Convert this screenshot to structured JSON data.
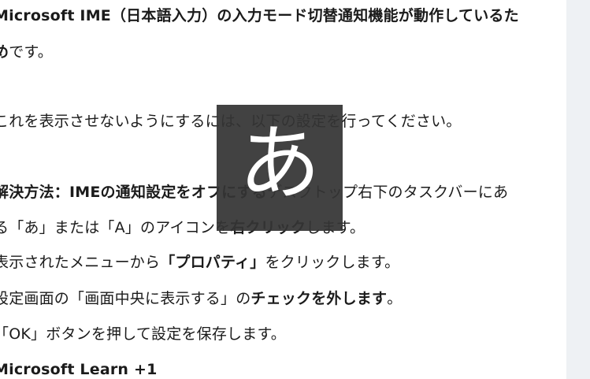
{
  "article": {
    "intro_line1": "Microsoft IME（日本語入力）の入力モード切替通知機能が動作しているた",
    "intro_line2_bold": "め",
    "intro_line2_rest": "です。",
    "instruction": "これを表示させないようにするには、以下の設定を行ってください。",
    "solution_label": "解決方法：IMEの通知設定をオフにする",
    "step1_part1": "デスクトップ右下のタスクバーにあ",
    "step1_part2": "る「あ」または「A」のアイコンを",
    "step1_bold": "右クリック",
    "step1_part3": "します。",
    "step2_part1": "表示されたメニューから",
    "step2_bold": "「プロパティ」",
    "step2_part2": "をクリックします。",
    "step3_part1": "設定画面の「画面中央に表示する」の",
    "step3_bold": "チェックを外します",
    "step3_part2": "。",
    "step4": "「OK」ボタンを押して設定を保存します。",
    "source": "Microsoft Learn +1"
  },
  "ime_overlay": {
    "glyph": "あ"
  }
}
